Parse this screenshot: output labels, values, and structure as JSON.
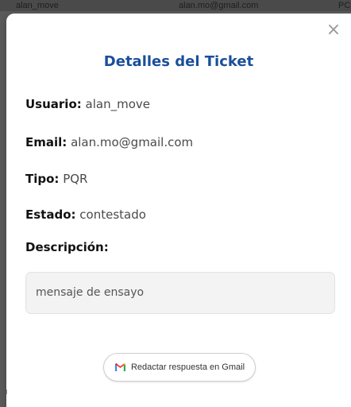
{
  "backdrop": {
    "user": "alan_move",
    "email": "alan.mo@gmail.com",
    "type": "PC"
  },
  "modal": {
    "close_glyph": "×",
    "close_icon": "close-icon",
    "title": "Detalles del Ticket",
    "fields": {
      "user": {
        "label": "Usuario:",
        "value": "alan_move"
      },
      "email": {
        "label": "Email:",
        "value": "alan.mo@gmail.com"
      },
      "type": {
        "label": "Tipo:",
        "value": "PQR"
      },
      "status": {
        "label": "Estado:",
        "value": "contestado"
      },
      "description": {
        "label": "Descripción:"
      }
    },
    "description_text": "mensaje de ensayo",
    "reply_button": {
      "label": "Redactar respuesta en Gmail",
      "icon": "gmail-icon"
    }
  },
  "colors": {
    "title": "#1a4f9a",
    "gmail_red": "#ea4335",
    "gmail_blue": "#4285f4",
    "gmail_green": "#34a853",
    "gmail_yellow": "#fbbc04"
  }
}
